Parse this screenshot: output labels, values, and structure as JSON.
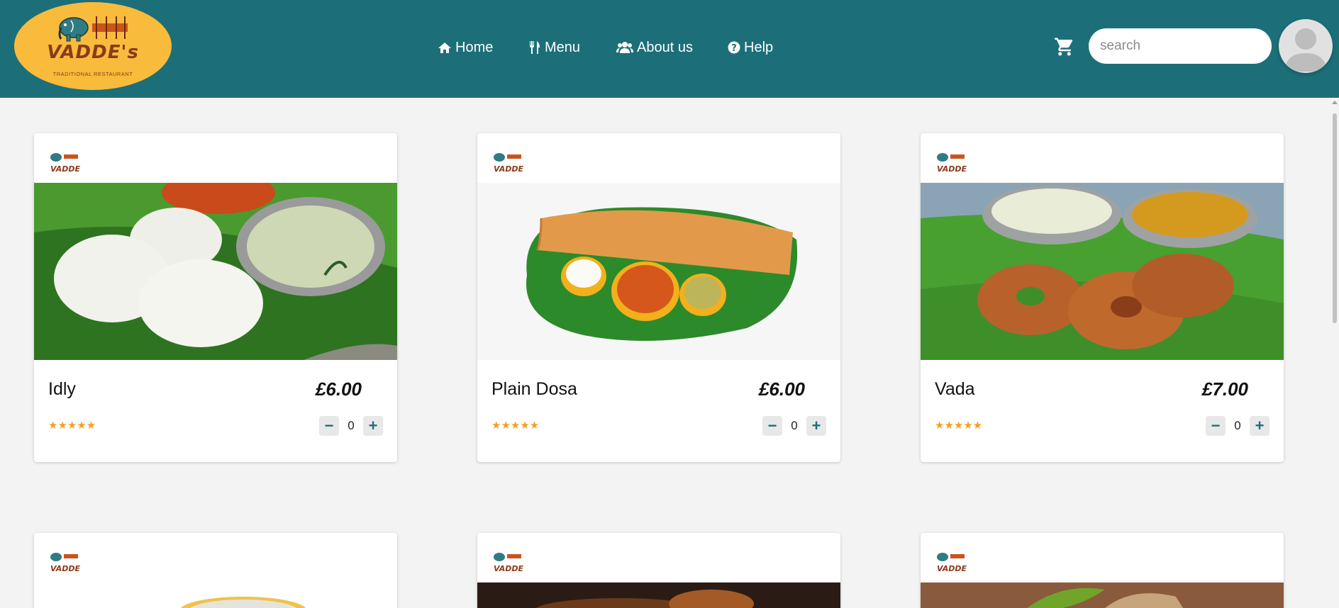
{
  "brand": {
    "name": "VADDE's",
    "tagline": "TRADITIONAL RESTAURANT"
  },
  "nav": [
    {
      "label": "Home",
      "icon": "home-icon"
    },
    {
      "label": "Menu",
      "icon": "cutlery-icon"
    },
    {
      "label": "About us",
      "icon": "users-icon"
    },
    {
      "label": "Help",
      "icon": "question-circle-icon"
    }
  ],
  "search": {
    "placeholder": "search",
    "value": ""
  },
  "colors": {
    "header": "#1c6f79",
    "logo_bg": "#f9bb3b",
    "star": "#f3a024",
    "page_bg": "#f2f3f2"
  },
  "items": [
    {
      "name": "Idly",
      "price": "£6.00",
      "rating": "★★★★★",
      "quantity": "0"
    },
    {
      "name": "Plain Dosa",
      "price": "£6.00",
      "rating": "★★★★★",
      "quantity": "0"
    },
    {
      "name": "Vada",
      "price": "£7.00",
      "rating": "★★★★★",
      "quantity": "0"
    }
  ],
  "controls": {
    "decrement": "−",
    "increment": "+"
  }
}
